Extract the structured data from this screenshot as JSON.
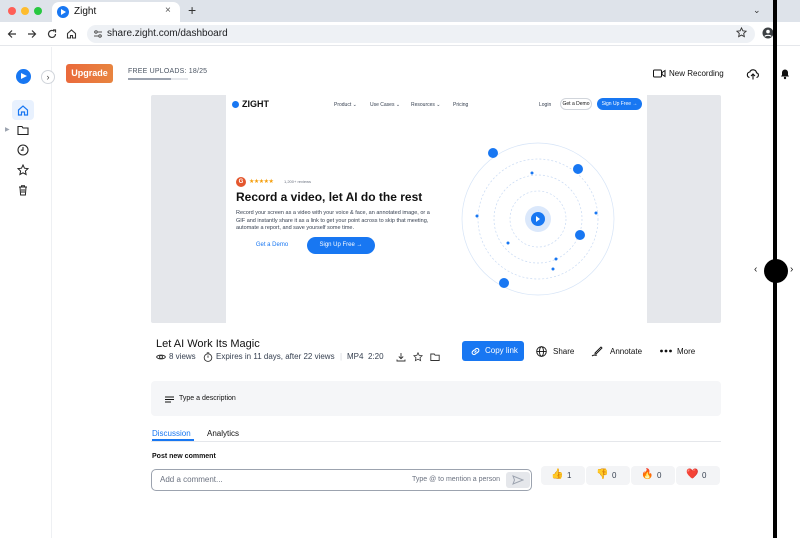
{
  "browser": {
    "tab_title": "Zight",
    "tab_close": "×",
    "new_tab": "+",
    "tab_menu": "⌄",
    "url": "share.zight.com/dashboard",
    "traffic_lights": [
      "#ff5f57",
      "#febc2e",
      "#28c840"
    ]
  },
  "header": {
    "upgrade_label": "Upgrade",
    "uploads_label": "FREE UPLOADS: 18/25",
    "uploads_fraction": 0.72,
    "new_recording_label": "New Recording"
  },
  "preview": {
    "logo": "ZIGHT",
    "nav": [
      "Product ⌄",
      "Use Cases ⌄",
      "Resources ⌄",
      "Pricing"
    ],
    "login": "Login",
    "get_demo_small": "Get a Demo",
    "sign_up_small": "Sign Up Free →",
    "g_badge": "G",
    "stars": "★★★★★",
    "reviews": "1,200+ reviews",
    "headline": "Record a video, let AI do the rest",
    "body": "Record your screen as a video with your voice & face, an annotated image, or a GIF and instantly share it as a link to get your point across to skip that meeting, automate a report, and save yourself some time.",
    "get_demo": "Get a Demo",
    "sign_up": "Sign Up Free →"
  },
  "video": {
    "title": "Let AI Work Its Magic",
    "views": "8 views",
    "expires": "Expires in 11 days, after 22 views",
    "format": "MP4",
    "duration": "2:20"
  },
  "actions": {
    "copy_link": "Copy link",
    "share": "Share",
    "annotate": "Annotate",
    "more": "More"
  },
  "description": {
    "placeholder": "Type a description"
  },
  "tabs": {
    "discussion": "Discussion",
    "analytics": "Analytics"
  },
  "comments": {
    "post_label": "Post new comment",
    "placeholder": "Add a comment...",
    "mention_hint": "Type @ to mention a person"
  },
  "reactions": [
    {
      "emoji": "👍",
      "count": "1"
    },
    {
      "emoji": "👎",
      "count": "0"
    },
    {
      "emoji": "🔥",
      "count": "0"
    },
    {
      "emoji": "❤️",
      "count": "0"
    }
  ],
  "colors": {
    "brand": "#1877f2",
    "upgrade": "#e8743e"
  }
}
